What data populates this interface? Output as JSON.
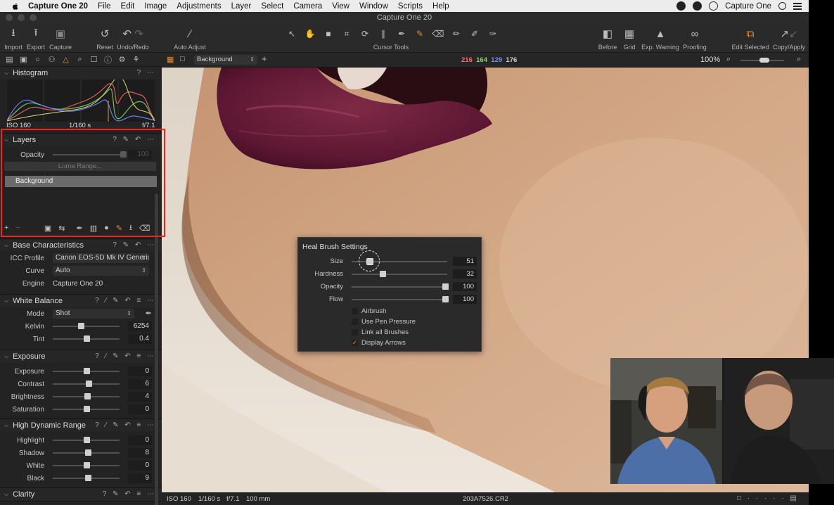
{
  "menubar": {
    "app_name": "Capture One 20",
    "menus": [
      "File",
      "Edit",
      "Image",
      "Adjustments",
      "Layer",
      "Select",
      "Camera",
      "View",
      "Window",
      "Scripts",
      "Help"
    ],
    "right_label": "Capture One"
  },
  "window": {
    "title": "Capture One 20"
  },
  "toolbar": {
    "import_label": "Import",
    "export_label": "Export",
    "capture_label": "Capture",
    "reset_label": "Reset",
    "undo_redo_label": "Undo/Redo",
    "auto_adjust_label": "Auto Adjust",
    "cursor_tools_label": "Cursor Tools",
    "before_label": "Before",
    "grid_label": "Grid",
    "exp_warning_label": "Exp. Warning",
    "proofing_label": "Proofing",
    "edit_selected_label": "Edit Selected",
    "copy_apply_label": "Copy/Apply"
  },
  "histogram": {
    "title": "Histogram",
    "iso": "ISO 160",
    "shutter": "1/160 s",
    "aperture": "f/7.1"
  },
  "layers": {
    "title": "Layers",
    "opacity_label": "Opacity",
    "opacity_value": "100",
    "luma_range_label": "Luma Range...",
    "layer_name": "Background"
  },
  "base_characteristics": {
    "title": "Base Characteristics",
    "icc_label": "ICC Profile",
    "icc_value": "Canon EOS-5D Mk IV Generic",
    "curve_label": "Curve",
    "curve_value": "Auto",
    "engine_label": "Engine",
    "engine_value": "Capture One 20"
  },
  "white_balance": {
    "title": "White Balance",
    "mode_label": "Mode",
    "mode_value": "Shot",
    "kelvin_label": "Kelvin",
    "kelvin_value": "6254",
    "kelvin_level": 0.42,
    "tint_label": "Tint",
    "tint_value": "0.4",
    "tint_level": 0.5
  },
  "exposure": {
    "title": "Exposure",
    "sliders": [
      {
        "label": "Exposure",
        "value": "0",
        "level": 0.5
      },
      {
        "label": "Contrast",
        "value": "6",
        "level": 0.54
      },
      {
        "label": "Brightness",
        "value": "4",
        "level": 0.52
      },
      {
        "label": "Saturation",
        "value": "0",
        "level": 0.5
      }
    ]
  },
  "hdr": {
    "title": "High Dynamic Range",
    "sliders": [
      {
        "label": "Highlight",
        "value": "0",
        "level": 0.5
      },
      {
        "label": "Shadow",
        "value": "8",
        "level": 0.53
      },
      {
        "label": "White",
        "value": "0",
        "level": 0.5
      },
      {
        "label": "Black",
        "value": "9",
        "level": 0.53
      }
    ]
  },
  "clarity": {
    "title": "Clarity"
  },
  "viewer": {
    "layer_select": "Background",
    "rgb": {
      "r": "216",
      "g": "164",
      "b": "129",
      "l": "176"
    },
    "zoom": "100%"
  },
  "heal_brush": {
    "title": "Heal Brush Settings",
    "sliders": [
      {
        "label": "Size",
        "value": "51",
        "level": 0.19
      },
      {
        "label": "Hardness",
        "value": "32",
        "level": 0.32
      },
      {
        "label": "Opacity",
        "value": "100",
        "level": 0.98
      },
      {
        "label": "Flow",
        "value": "100",
        "level": 0.98
      }
    ],
    "options": [
      {
        "label": "Airbrush",
        "checked": false
      },
      {
        "label": "Use Pen Pressure",
        "checked": false
      },
      {
        "label": "Link all Brushes",
        "checked": false
      },
      {
        "label": "Display Arrows",
        "checked": true
      }
    ]
  },
  "statusbar": {
    "iso": "ISO 160",
    "shutter": "1/160 s",
    "aperture": "f/7.1",
    "focal": "100 mm",
    "filename": "203A7526.CR2"
  },
  "colors": {
    "accent": "#e8892c",
    "highlight_outline": "#ff1d1d",
    "rgb_r": "#ff6b6b",
    "rgb_g": "#8fd16a",
    "rgb_b": "#7a8cff"
  }
}
